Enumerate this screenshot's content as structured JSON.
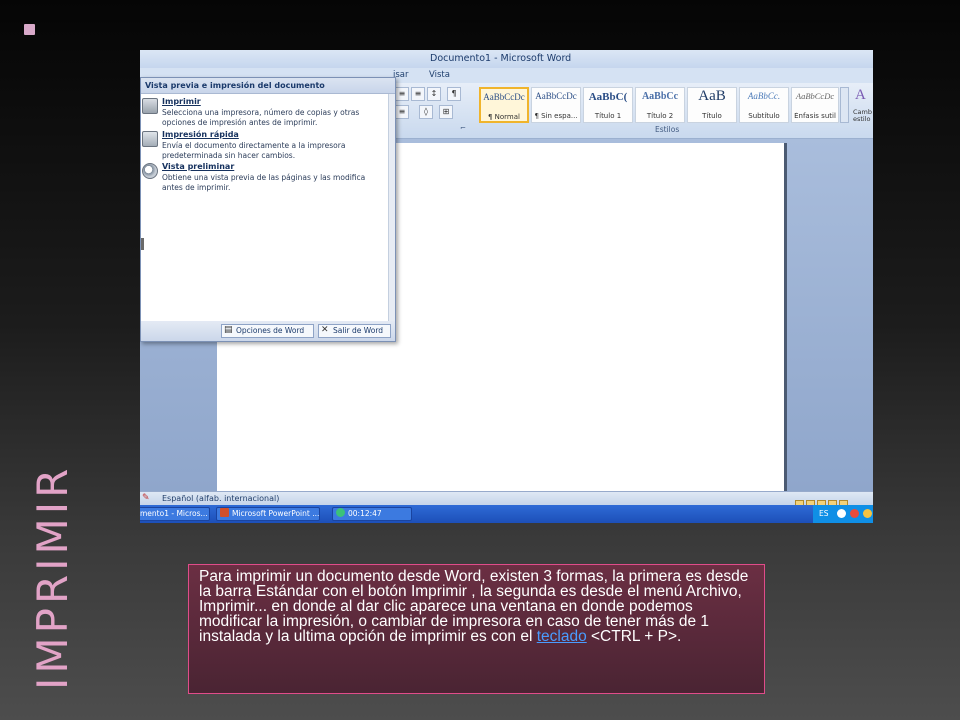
{
  "slide": {
    "title": "IMPRIMIR",
    "body_text": "Para imprimir un documento desde Word, existen 3 formas, la primera es desde la barra Estándar con el botón Imprimir , la segunda es desde el menú Archivo, Imprimir... en donde al dar clic aparece una ventana en donde podemos modificar la impresión, o cambiar de impresora en caso de tener más de 1 instalada y la ultima opción de imprimir es con el",
    "link_text": "teclado",
    "body_tail": " <CTRL + P>."
  },
  "word": {
    "window_title": "Documento1 - Microsoft Word",
    "menu_tabs": [
      "isar",
      "Vista"
    ],
    "ribbon_group_paragraph": "fo",
    "ribbon_group_styles": "Estilos",
    "styles": [
      {
        "preview": "AaBbCcDc",
        "name": "¶ Normal",
        "selected": true
      },
      {
        "preview": "AaBbCcDc",
        "name": "¶ Sin espa...",
        "selected": false
      },
      {
        "preview": "AaBbC(",
        "name": "Título 1",
        "selected": false
      },
      {
        "preview": "AaBbCc",
        "name": "Título 2",
        "selected": false
      },
      {
        "preview": "AaB",
        "name": "Título",
        "selected": false
      },
      {
        "preview": "AaBbCc.",
        "name": "Subtítulo",
        "selected": false
      },
      {
        "preview": "AaBbCcDc",
        "name": "Énfasis sutil",
        "selected": false
      }
    ],
    "change_styles": {
      "icon": "A",
      "label": "Camb estilo"
    },
    "office_menu": {
      "header": "Vista previa e impresión del documento",
      "items": [
        {
          "title": "Imprimir",
          "icon": "printer-icon",
          "desc": "Selecciona una impresora, número de copias y otras opciones de impresión antes de imprimir."
        },
        {
          "title": "Impresión rápida",
          "icon": "quick-print-icon",
          "desc": "Envía el documento directamente a la impresora predeterminada sin hacer cambios."
        },
        {
          "title": "Vista preliminar",
          "icon": "print-preview-icon",
          "desc": "Obtiene una vista previa de las páginas y las modifica antes de imprimir."
        }
      ],
      "options_button": "Opciones de Word",
      "exit_button": "Salir de Word"
    },
    "status_language": "Español (alfab. internacional)",
    "taskbar": {
      "tasks": [
        "mento1 - Micros...",
        "Microsoft PowerPoint ...",
        "00:12:47"
      ],
      "tray_lang": "ES"
    }
  }
}
